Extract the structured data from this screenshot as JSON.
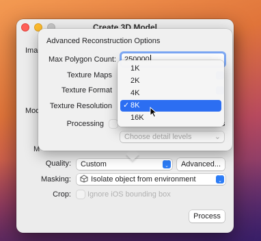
{
  "window": {
    "title": "Create 3D Model"
  },
  "background_labels": {
    "image": "Imag",
    "model": "Mod",
    "ma": "M"
  },
  "settings": {
    "quality_label": "Quality:",
    "quality_value": "Custom",
    "advanced_button": "Advanced...",
    "masking_label": "Masking:",
    "masking_value": "Isolate object from environment",
    "crop_label": "Crop:",
    "crop_option": "Ignore iOS bounding box",
    "process_button": "Process"
  },
  "popover": {
    "heading": "Advanced Reconstruction Options",
    "max_polygon_label": "Max Polygon Count:",
    "max_polygon_value": "250000",
    "texture_maps_label": "Texture Maps",
    "texture_format_label": "Texture Format",
    "texture_resolution_label": "Texture Resolution",
    "processing_label": "Processing",
    "processing_option_tail": "s",
    "detail_placeholder": "Choose detail levels"
  },
  "resolution_menu": {
    "items": [
      "1K",
      "2K",
      "4K",
      "8K",
      "16K"
    ],
    "selected": "8K"
  },
  "colors": {
    "accent": "#2c6ef2",
    "close": "#ff5f57",
    "minimize": "#febc2e"
  },
  "icons": [
    "chevron-updown-icon",
    "checkmark-icon",
    "isolate-object-icon",
    "pointer-cursor-icon"
  ]
}
